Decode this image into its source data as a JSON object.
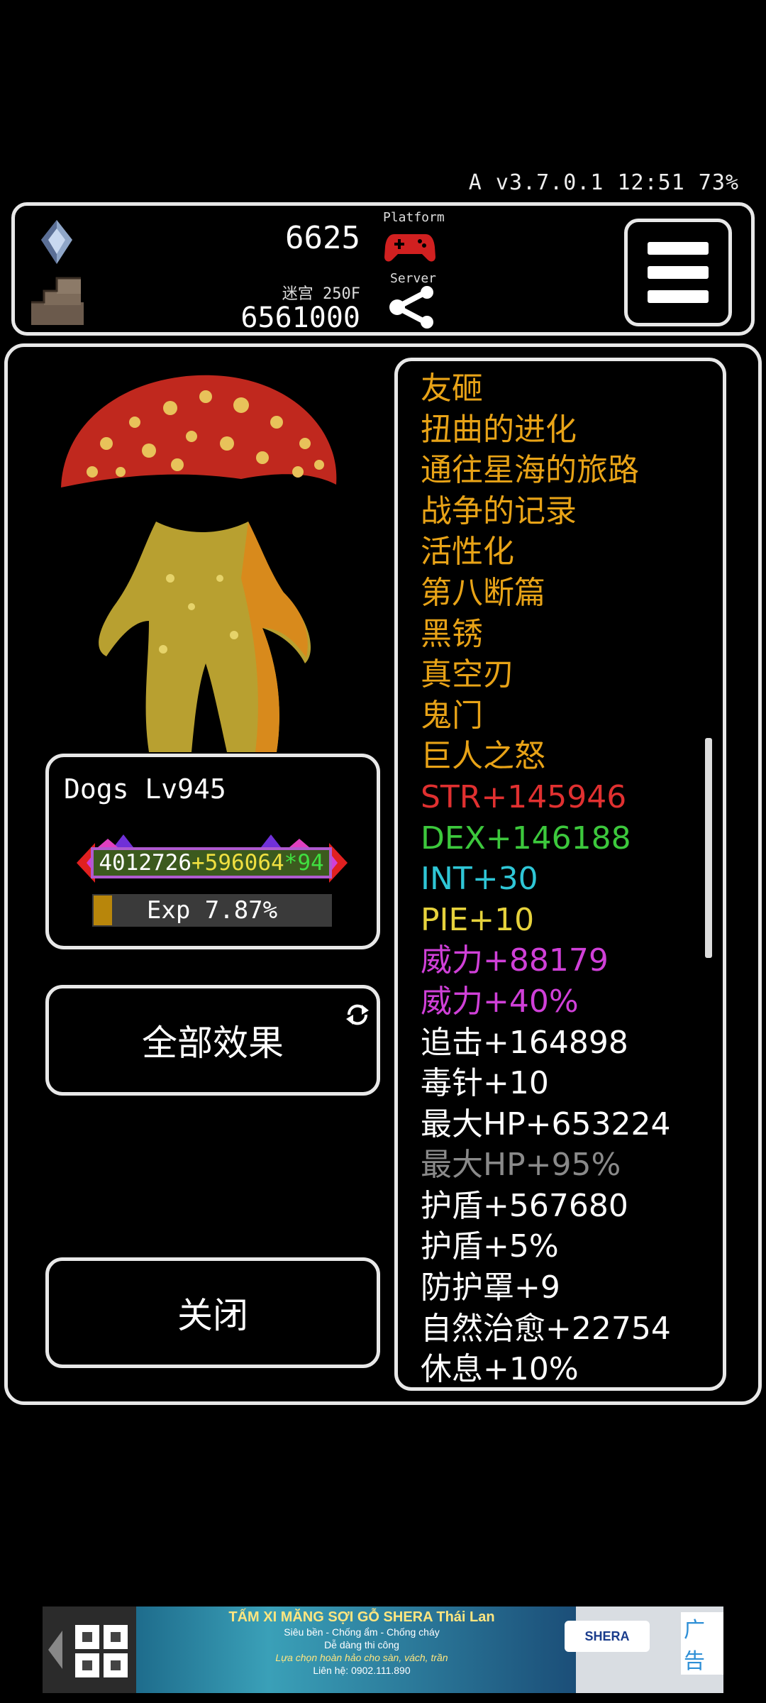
{
  "status_bar": {
    "text": "A v3.7.0.1 12:51 73%"
  },
  "topbar": {
    "gem_count": "6625",
    "floor_label": "迷宫 250F",
    "floor_gold": "6561000",
    "platform_label": "Platform",
    "server_label": "Server",
    "icons": [
      "gem-icon",
      "dungeon-stairs-icon",
      "gamepad-icon",
      "share-icon",
      "menu-icon"
    ],
    "gamepad_color": "#d12020"
  },
  "monster": {
    "name_level": "Dogs Lv945",
    "hp_text": "4012726+596064*94",
    "exp_text": "Exp 7.87%",
    "exp_fraction": 0.0787
  },
  "buttons": {
    "all_effects": "全部效果",
    "close": "关闭"
  },
  "effects": [
    {
      "text": "友砸",
      "color": "#e8a317"
    },
    {
      "text": "扭曲的进化",
      "color": "#e8a317"
    },
    {
      "text": "通往星海的旅路",
      "color": "#e8a317"
    },
    {
      "text": "战争的记录",
      "color": "#e8a317"
    },
    {
      "text": "活性化",
      "color": "#e8a317"
    },
    {
      "text": "第八断篇",
      "color": "#e8a317"
    },
    {
      "text": "黑锈",
      "color": "#e8a317"
    },
    {
      "text": "真空刃",
      "color": "#e8a317"
    },
    {
      "text": "鬼门",
      "color": "#e8a317"
    },
    {
      "text": "巨人之怒",
      "color": "#e8a317"
    },
    {
      "text": "STR+145946",
      "color": "#e03030"
    },
    {
      "text": "DEX+146188",
      "color": "#3cc83c"
    },
    {
      "text": "INT+30",
      "color": "#2fc6d6"
    },
    {
      "text": "PIE+10",
      "color": "#e6d23c"
    },
    {
      "text": "威力+88179",
      "color": "#d040d8"
    },
    {
      "text": "威力+40%",
      "color": "#d040d8"
    },
    {
      "text": "追击+164898",
      "color": "#ffffff"
    },
    {
      "text": "毒针+10",
      "color": "#ffffff"
    },
    {
      "text": "最大HP+653224",
      "color": "#ffffff"
    },
    {
      "text": "最大HP+95%",
      "color": "#8a8a8a"
    },
    {
      "text": "护盾+567680",
      "color": "#ffffff"
    },
    {
      "text": "护盾+5%",
      "color": "#ffffff"
    },
    {
      "text": "防护罩+9",
      "color": "#ffffff"
    },
    {
      "text": "自然治愈+22754",
      "color": "#ffffff"
    },
    {
      "text": "休息+10%",
      "color": "#ffffff"
    }
  ],
  "ad": {
    "title": "TẤM XI MĂNG SỢI GỖ SHERA Thái Lan",
    "line1": "Siêu bền - Chống ẩm - Chống cháy",
    "line2": "Dễ dàng thi công",
    "line3": "Lựa chọn hoàn hảo cho sàn, vách, trần",
    "line4": "Liên hệ: 0902.111.890",
    "brand": "SHERA",
    "label": "广告"
  }
}
